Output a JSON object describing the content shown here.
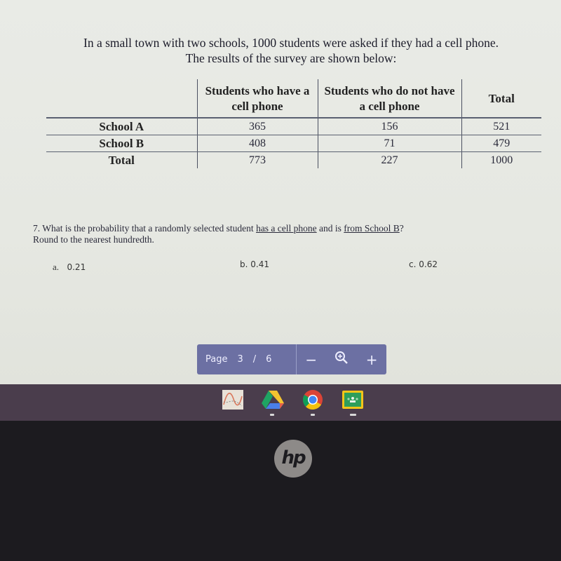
{
  "document": {
    "intro_line1": "In a small town with two schools, 1000 students were asked if they had a cell phone.",
    "intro_line2": "The results of the survey are shown below:",
    "table": {
      "headers": [
        "",
        "Students who have a cell phone",
        "Students who do not have a cell phone",
        "Total"
      ],
      "rows": [
        {
          "label": "School A",
          "values": [
            "365",
            "156",
            "521"
          ]
        },
        {
          "label": "School B",
          "values": [
            "408",
            "71",
            "479"
          ]
        },
        {
          "label": "Total",
          "values": [
            "773",
            "227",
            "1000"
          ]
        }
      ]
    },
    "question": {
      "prefix": "7. What is the probability that a randomly selected student ",
      "underline1": "has a cell phone",
      "middle": " and is ",
      "underline2": "from School B",
      "suffix": "?",
      "line2": "Round to the nearest hundredth."
    },
    "options": [
      {
        "letter": "a.",
        "value": "0.21"
      },
      {
        "letter": "b.",
        "value": "0.41"
      },
      {
        "letter": "c.",
        "value": "0.62"
      }
    ]
  },
  "pager": {
    "label": "Page",
    "current": "3",
    "separator": "/",
    "total": "6",
    "zoom_out": "−",
    "zoom_in": "+",
    "zoom_icon": "magnifier-plus"
  },
  "taskbar": {
    "apps": [
      {
        "name": "graph-app",
        "icon": "sine-graph"
      },
      {
        "name": "google-drive",
        "icon": "drive-triangle"
      },
      {
        "name": "chrome",
        "icon": "chrome-logo"
      },
      {
        "name": "google-classroom",
        "icon": "classroom-board"
      }
    ]
  },
  "bezel": {
    "logo": "hp"
  }
}
